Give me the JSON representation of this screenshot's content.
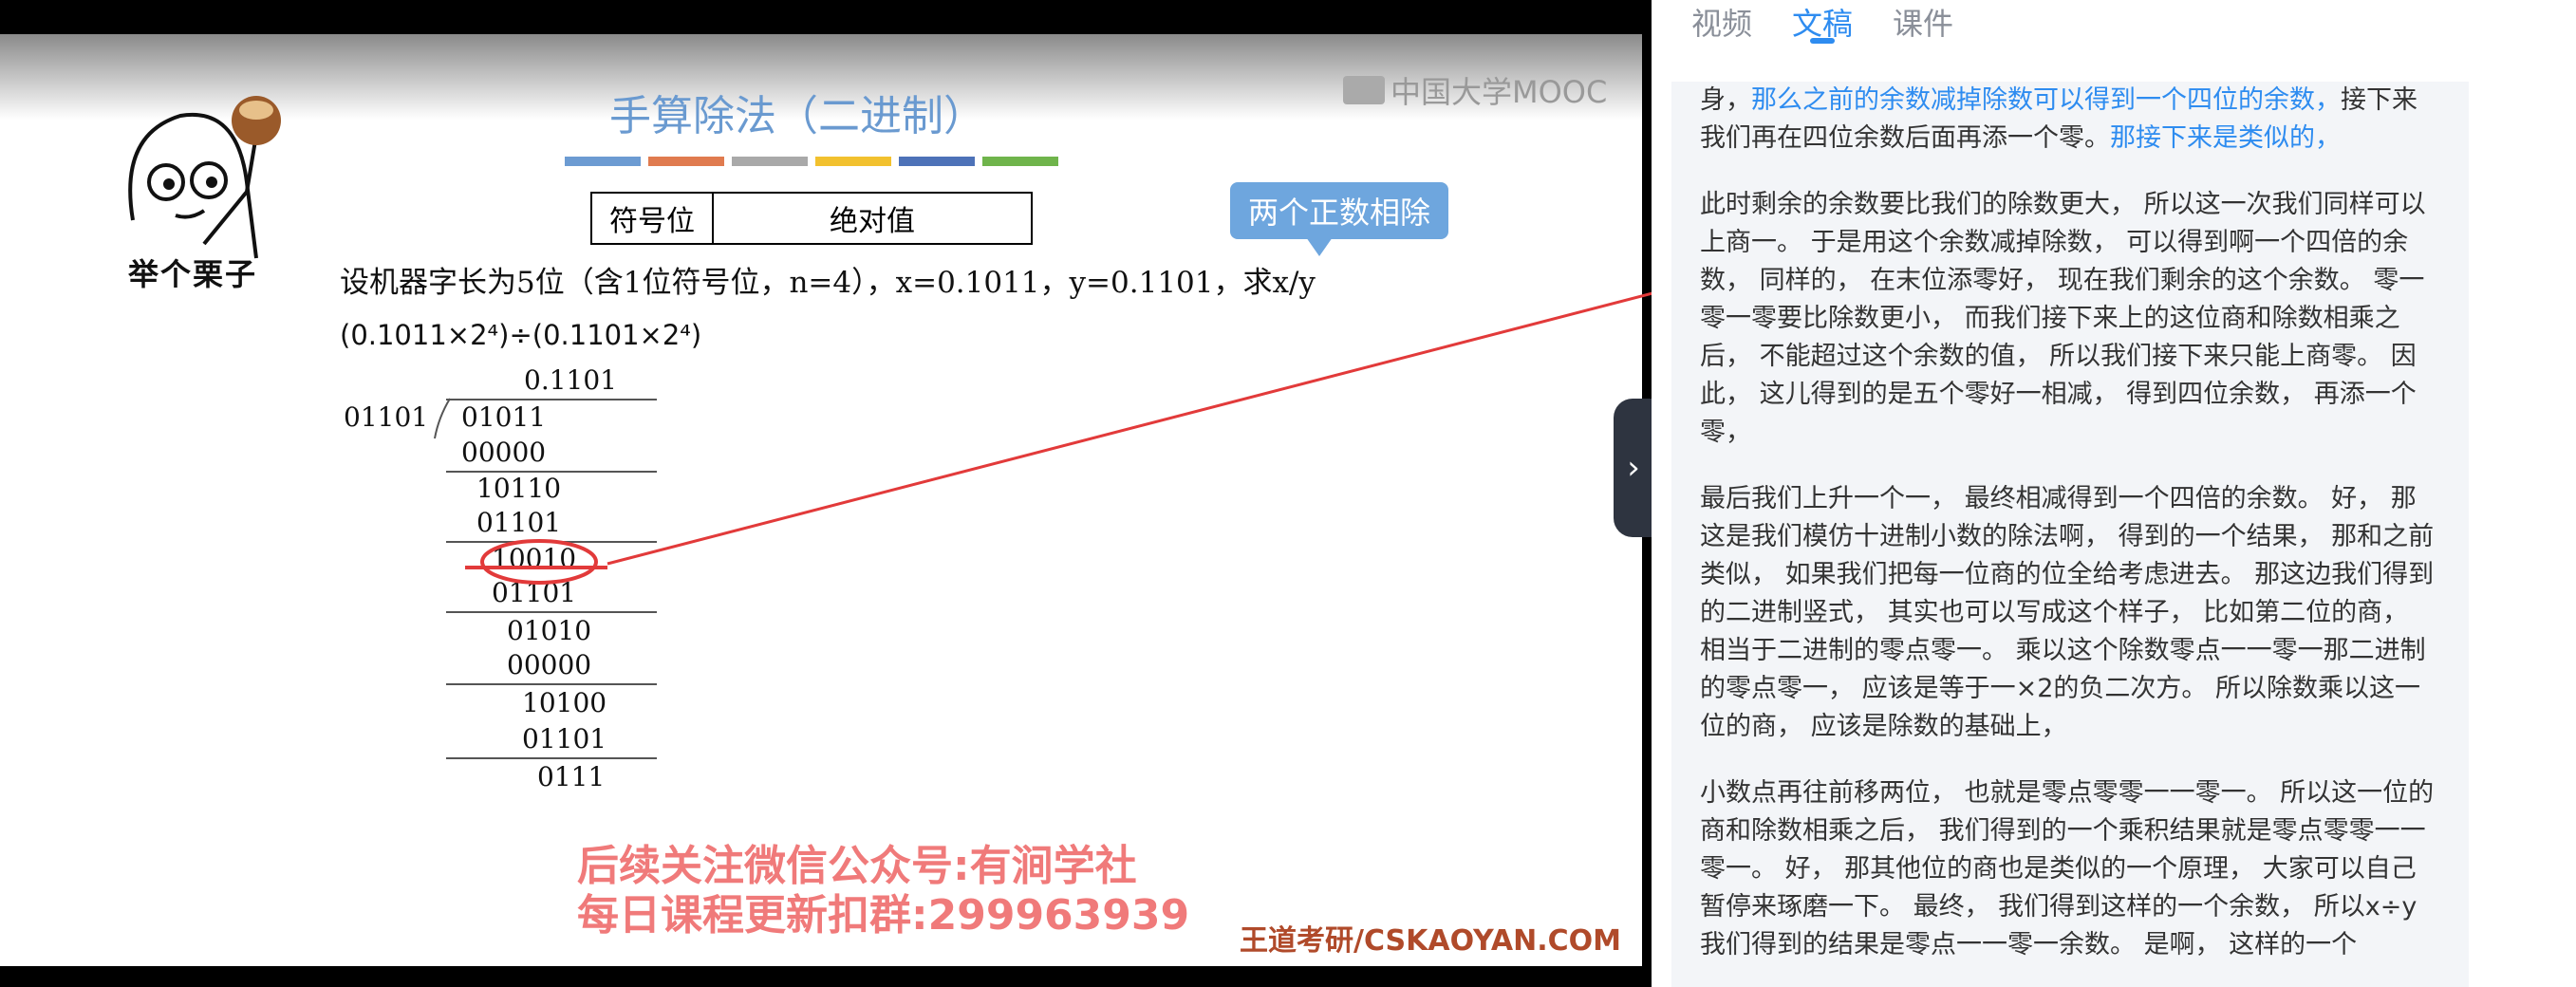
{
  "slide": {
    "title": "手算除法（二进制）",
    "mooc_logo": "中国大学MOOC",
    "mascot_caption": "举个栗子",
    "bar_colors": [
      "#6c9bd2",
      "#e07b4f",
      "#a9a9a9",
      "#f2c12e",
      "#4d72b8",
      "#6fb44b"
    ],
    "table": {
      "col1": "符号位",
      "col2": "绝对值"
    },
    "bubble": "两个正数相除",
    "problem": "设机器字长为5位（含1位符号位，n=4），x=0.1011，y=0.1101，求x/y",
    "formula": "(0.1011×2⁴)÷(0.1101×2⁴)",
    "division": {
      "quotient": "0.1101",
      "divisor": "01101",
      "dividend": "01011",
      "steps": [
        "00000",
        "10110",
        "01101",
        "10010",
        "01101",
        "01010",
        "00000",
        "10100",
        "01101",
        "0111"
      ]
    },
    "ad_line1": "后续关注微信公众号:有涧学社",
    "ad_line2": "每日课程更新扣群:299963939",
    "brand": "王道考研/CSKAOYAN.COM"
  },
  "panel": {
    "tabs": [
      {
        "label": "视频",
        "active": false
      },
      {
        "label": "文稿",
        "active": true
      },
      {
        "label": "课件",
        "active": false
      }
    ],
    "collapse_icon": "›",
    "p1_a": "身，",
    "p1_b": "那么之前的余数减掉除数可以得到一个四位的余数，",
    "p1_c": "接下来我们再在四位余数后面再添一个零。",
    "p1_d": "那接下来是类似的，",
    "p2": "此时剩余的余数要比我们的除数更大， 所以这一次我们同样可以上商一。 于是用这个余数减掉除数， 可以得到啊一个四倍的余数， 同样的， 在末位添零好， 现在我们剩余的这个余数。 零一零一零要比除数更小， 而我们接下来上的这位商和除数相乘之后， 不能超过这个余数的值， 所以我们接下来只能上商零。 因此， 这儿得到的是五个零好一相减， 得到四位余数， 再添一个零，",
    "p3": "最后我们上升一个一， 最终相减得到一个四倍的余数。 好， 那这是我们模仿十进制小数的除法啊， 得到的一个结果， 那和之前类似， 如果我们把每一位商的位全给考虑进去。 那这边我们得到的二进制竖式， 其实也可以写成这个样子， 比如第二位的商， 相当于二进制的零点零一。 乘以这个除数零点一一零一那二进制的零点零一， 应该是等于一×2的负二次方。 所以除数乘以这一位的商， 应该是除数的基础上，",
    "p4": "小数点再往前移两位， 也就是零点零零一一零一。 所以这一位的商和除数相乘之后， 我们得到的一个乘积结果就是零点零零一一零一。 好， 那其他位的商也是类似的一个原理， 大家可以自己暂停来琢磨一下。 最终， 我们得到这样的一个余数， 所以x÷y我们得到的结果是零点一一零一余数。 是啊， 这样的一个"
  }
}
